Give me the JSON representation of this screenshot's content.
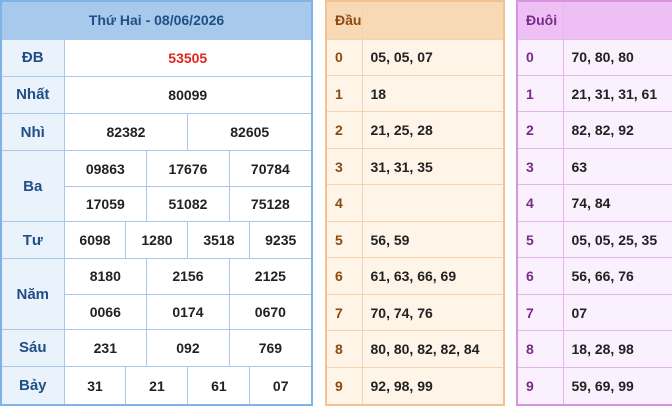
{
  "results": {
    "title": "Thứ Hai - 08/06/2026",
    "prizes": [
      {
        "label": "ĐB",
        "values": [
          "53505"
        ]
      },
      {
        "label": "Nhất",
        "values": [
          "80099"
        ]
      },
      {
        "label": "Nhì",
        "values": [
          "82382",
          "82605"
        ]
      },
      {
        "label": "Ba",
        "values": [
          "09863",
          "17676",
          "70784",
          "17059",
          "51082",
          "75128"
        ]
      },
      {
        "label": "Tư",
        "values": [
          "6098",
          "1280",
          "3518",
          "9235"
        ]
      },
      {
        "label": "Năm",
        "values": [
          "8180",
          "2156",
          "2125",
          "0066",
          "0174",
          "0670"
        ]
      },
      {
        "label": "Sáu",
        "values": [
          "231",
          "092",
          "769"
        ]
      },
      {
        "label": "Bảy",
        "values": [
          "31",
          "21",
          "61",
          "07"
        ]
      }
    ]
  },
  "head": {
    "title": "Đầu",
    "rows": [
      {
        "digit": "0",
        "values": "05, 05, 07"
      },
      {
        "digit": "1",
        "values": "18"
      },
      {
        "digit": "2",
        "values": "21, 25, 28"
      },
      {
        "digit": "3",
        "values": "31, 31, 35"
      },
      {
        "digit": "4",
        "values": ""
      },
      {
        "digit": "5",
        "values": "56, 59"
      },
      {
        "digit": "6",
        "values": "61, 63, 66, 69"
      },
      {
        "digit": "7",
        "values": "70, 74, 76"
      },
      {
        "digit": "8",
        "values": "80, 80, 82, 82, 84"
      },
      {
        "digit": "9",
        "values": "92, 98, 99"
      }
    ]
  },
  "tail": {
    "title": "Đuôi",
    "rows": [
      {
        "digit": "0",
        "values": "70, 80, 80"
      },
      {
        "digit": "1",
        "values": "21, 31, 31, 61"
      },
      {
        "digit": "2",
        "values": "82, 82, 92"
      },
      {
        "digit": "3",
        "values": "63"
      },
      {
        "digit": "4",
        "values": "74, 84"
      },
      {
        "digit": "5",
        "values": "05, 05, 25, 35"
      },
      {
        "digit": "6",
        "values": "56, 66, 76"
      },
      {
        "digit": "7",
        "values": "07"
      },
      {
        "digit": "8",
        "values": "18, 28, 98"
      },
      {
        "digit": "9",
        "values": "59, 69, 99"
      }
    ]
  },
  "colors": {
    "special_prize": "#e0251c",
    "results_header": "#a7c9ec",
    "head_header": "#f8d9b6",
    "tail_header": "#eebff5"
  }
}
